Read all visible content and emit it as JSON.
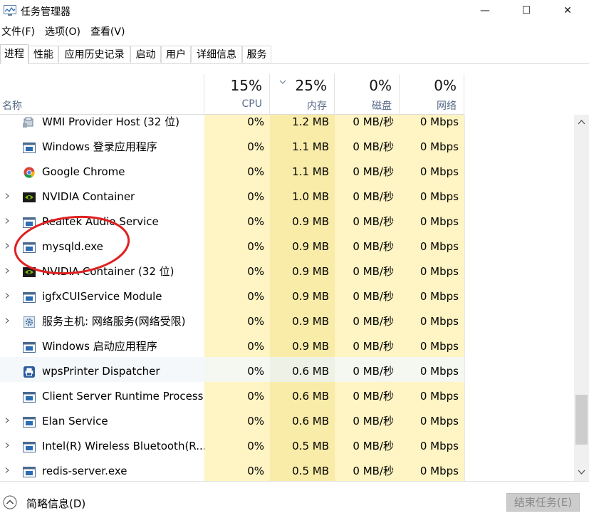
{
  "window": {
    "title": "任务管理器",
    "minimize_glyph": "—",
    "maximize_glyph": "☐",
    "close_glyph": "✕"
  },
  "menu": [
    "文件(F)",
    "选项(O)",
    "查看(V)"
  ],
  "tabs": [
    {
      "label": "进程",
      "active": true
    },
    {
      "label": "性能",
      "active": false
    },
    {
      "label": "应用历史记录",
      "active": false
    },
    {
      "label": "启动",
      "active": false
    },
    {
      "label": "用户",
      "active": false
    },
    {
      "label": "详细信息",
      "active": false
    },
    {
      "label": "服务",
      "active": false
    }
  ],
  "columns": {
    "name": {
      "label": "名称"
    },
    "cpu": {
      "percent": "15%",
      "label": "CPU"
    },
    "memory": {
      "percent": "25%",
      "label": "内存"
    },
    "disk": {
      "percent": "0%",
      "label": "磁盘"
    },
    "network": {
      "percent": "0%",
      "label": "网络"
    }
  },
  "processes": [
    {
      "name": "WMI Provider Host (32 位)",
      "icon": "wmi-host-icon",
      "expandable": false,
      "cpu": "0%",
      "memory": "1.2 MB",
      "disk": "0 MB/秒",
      "network": "0 Mbps",
      "selected": false
    },
    {
      "name": "Windows 登录应用程序",
      "icon": "window-app-icon",
      "expandable": false,
      "cpu": "0%",
      "memory": "1.1 MB",
      "disk": "0 MB/秒",
      "network": "0 Mbps",
      "selected": false
    },
    {
      "name": "Google Chrome",
      "icon": "chrome-icon",
      "expandable": false,
      "cpu": "0%",
      "memory": "1.1 MB",
      "disk": "0 MB/秒",
      "network": "0 Mbps",
      "selected": false
    },
    {
      "name": "NVIDIA Container",
      "icon": "nvidia-icon",
      "expandable": true,
      "cpu": "0%",
      "memory": "1.0 MB",
      "disk": "0 MB/秒",
      "network": "0 Mbps",
      "selected": false
    },
    {
      "name": "Realtek Audio Service",
      "icon": "window-app-icon",
      "expandable": true,
      "cpu": "0%",
      "memory": "0.9 MB",
      "disk": "0 MB/秒",
      "network": "0 Mbps",
      "selected": false
    },
    {
      "name": "mysqld.exe",
      "icon": "window-app-icon",
      "expandable": true,
      "cpu": "0%",
      "memory": "0.9 MB",
      "disk": "0 MB/秒",
      "network": "0 Mbps",
      "selected": false
    },
    {
      "name": "NVIDIA Container (32 位)",
      "icon": "nvidia-icon",
      "expandable": true,
      "cpu": "0%",
      "memory": "0.9 MB",
      "disk": "0 MB/秒",
      "network": "0 Mbps",
      "selected": false
    },
    {
      "name": "igfxCUIService Module",
      "icon": "window-app-icon",
      "expandable": true,
      "cpu": "0%",
      "memory": "0.9 MB",
      "disk": "0 MB/秒",
      "network": "0 Mbps",
      "selected": false
    },
    {
      "name": "服务主机: 网络服务(网络受限)",
      "icon": "gear-icon",
      "expandable": true,
      "cpu": "0%",
      "memory": "0.9 MB",
      "disk": "0 MB/秒",
      "network": "0 Mbps",
      "selected": false
    },
    {
      "name": "Windows 启动应用程序",
      "icon": "window-app-icon",
      "expandable": false,
      "cpu": "0%",
      "memory": "0.9 MB",
      "disk": "0 MB/秒",
      "network": "0 Mbps",
      "selected": false
    },
    {
      "name": "wpsPrinter Dispatcher",
      "icon": "printer-icon",
      "expandable": false,
      "cpu": "0%",
      "memory": "0.6 MB",
      "disk": "0 MB/秒",
      "network": "0 Mbps",
      "selected": true
    },
    {
      "name": "Client Server Runtime Process",
      "icon": "window-app-icon",
      "expandable": false,
      "cpu": "0%",
      "memory": "0.6 MB",
      "disk": "0 MB/秒",
      "network": "0 Mbps",
      "selected": false
    },
    {
      "name": "Elan Service",
      "icon": "window-app-icon",
      "expandable": true,
      "cpu": "0%",
      "memory": "0.6 MB",
      "disk": "0 MB/秒",
      "network": "0 Mbps",
      "selected": false
    },
    {
      "name": "Intel(R) Wireless Bluetooth(R...",
      "icon": "window-app-icon",
      "expandable": true,
      "cpu": "0%",
      "memory": "0.5 MB",
      "disk": "0 MB/秒",
      "network": "0 Mbps",
      "selected": false
    },
    {
      "name": "redis-server.exe",
      "icon": "window-app-icon",
      "expandable": true,
      "cpu": "0%",
      "memory": "0.5 MB",
      "disk": "0 MB/秒",
      "network": "0 Mbps",
      "selected": false
    }
  ],
  "footer": {
    "fewer_details": "简略信息(D)",
    "end_task": "结束任务(E)"
  },
  "colors": {
    "heat_light": "#fff4c3",
    "heat_mid": "#f9eca8",
    "annotation": "#e02020",
    "header_label": "#5a6d89"
  },
  "annotation": {
    "type": "red-ellipse",
    "highlights": "mysqld.exe"
  }
}
